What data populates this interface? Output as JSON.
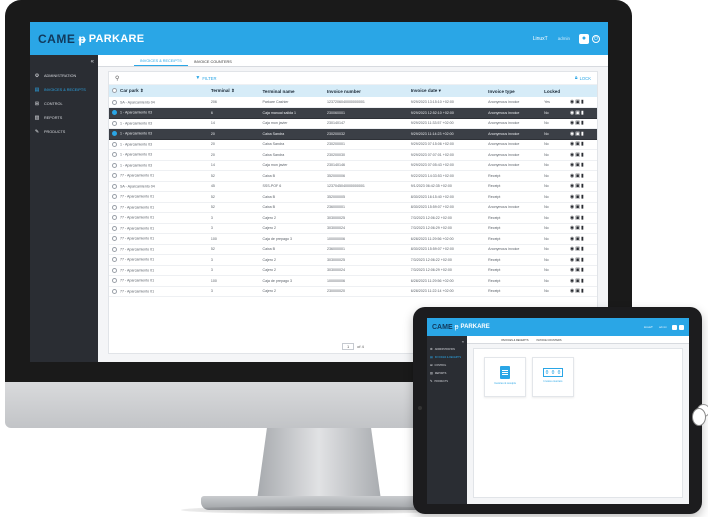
{
  "desktop": {
    "header": {
      "logo_came": "CAME",
      "logo_parkare": "PARKARE",
      "user_name": "LinuxT",
      "user_role": "admin"
    },
    "sidebar": {
      "collapse_symbol": "«",
      "items": [
        {
          "label": "ADMINISTRATION",
          "icon": "gear-icon",
          "glyph": "⚙",
          "active": false
        },
        {
          "label": "INVOICES & RECEIPTS",
          "icon": "receipt-icon",
          "glyph": "▤",
          "active": true
        },
        {
          "label": "CONTROL",
          "icon": "grid-icon",
          "glyph": "⊞",
          "active": false
        },
        {
          "label": "REPORTS",
          "icon": "bar-chart-icon",
          "glyph": "▥",
          "active": false
        },
        {
          "label": "PRODUCTS",
          "icon": "ticket-icon",
          "glyph": "✎",
          "active": false
        }
      ]
    },
    "tabs": [
      {
        "label": "INVOICES & RECEIPTS",
        "active": true
      },
      {
        "label": "INVOICE COUNTERS",
        "active": false
      }
    ],
    "toolbar": {
      "filter_label": "FILTER",
      "lock_label": "LOCK"
    },
    "table": {
      "columns": [
        "Car park",
        "Terminal",
        "Terminal name",
        "Invoice number",
        "Invoice date",
        "Invoice type",
        "Locked"
      ],
      "rows": [
        {
          "car_park": "SA - Aparcamiento 04",
          "terminal": "206",
          "terminal_name": "Parkare Cashier",
          "invoice_number": "1237206040000000001",
          "invoice_date": "9/29/2023 13:15:10 +02:00",
          "invoice_type": "Anonymous invoice",
          "locked": "Yes",
          "selected": false
        },
        {
          "car_park": "1 - Aparcamiento 03",
          "terminal": "6",
          "terminal_name": "Caja manual salida 1",
          "invoice_number": "230060001",
          "invoice_date": "9/29/2023 12:52:10 +02:00",
          "invoice_type": "Anonymous invoice",
          "locked": "No",
          "selected": true
        },
        {
          "car_park": "1 - Aparcamiento 03",
          "terminal": "14",
          "terminal_name": "Caja mon javier",
          "invoice_number": "230140147",
          "invoice_date": "9/29/2023 11:33:57 +02:00",
          "invoice_type": "Anonymous invoice",
          "locked": "No",
          "selected": false
        },
        {
          "car_park": "1 - Aparcamiento 03",
          "terminal": "20",
          "terminal_name": "Caixa Sandra",
          "invoice_number": "230200032",
          "invoice_date": "9/29/2023 11:14:23 +02:00",
          "invoice_type": "Anonymous invoice",
          "locked": "No",
          "selected": true
        },
        {
          "car_park": "1 - Aparcamiento 03",
          "terminal": "20",
          "terminal_name": "Caixa Sandra",
          "invoice_number": "230200001",
          "invoice_date": "9/29/2023 07:15:06 +02:00",
          "invoice_type": "Anonymous invoice",
          "locked": "No",
          "selected": false
        },
        {
          "car_park": "1 - Aparcamiento 03",
          "terminal": "20",
          "terminal_name": "Caixa Sandra",
          "invoice_number": "230200030",
          "invoice_date": "9/29/2023 07:07:01 +02:00",
          "invoice_type": "Anonymous invoice",
          "locked": "No",
          "selected": false
        },
        {
          "car_park": "1 - Aparcamiento 03",
          "terminal": "14",
          "terminal_name": "Caja mon javier",
          "invoice_number": "230140146",
          "invoice_date": "9/29/2023 07:05:43 +02:00",
          "invoice_type": "Anonymous invoice",
          "locked": "No",
          "selected": false
        },
        {
          "car_park": "77 - Aparcamiento 01",
          "terminal": "52",
          "terminal_name": "Caixa B",
          "invoice_number": "352000006",
          "invoice_date": "9/22/2023 14:33:53 +02:00",
          "invoice_type": "Receipt",
          "locked": "No",
          "selected": false
        },
        {
          "car_park": "SA - Aparcamiento 04",
          "terminal": "45",
          "terminal_name": "SSS-POF 6",
          "invoice_number": "1237045040000000001",
          "invoice_date": "9/1/2023 06:42:35 +02:00",
          "invoice_type": "Receipt",
          "locked": "No",
          "selected": false
        },
        {
          "car_park": "77 - Aparcamiento 01",
          "terminal": "52",
          "terminal_name": "Caixa B",
          "invoice_number": "352000005",
          "invoice_date": "8/30/2023 16:15:40 +02:00",
          "invoice_type": "Receipt",
          "locked": "No",
          "selected": false
        },
        {
          "car_park": "77 - Aparcamiento 01",
          "terminal": "52",
          "terminal_name": "Caixa B",
          "invoice_number": "236000001",
          "invoice_date": "8/30/2023 15:59:07 +02:00",
          "invoice_type": "Anonymous invoice",
          "locked": "No",
          "selected": false
        },
        {
          "car_park": "77 - Aparcamiento 01",
          "terminal": "3",
          "terminal_name": "Cajero 2",
          "invoice_number": "303000025",
          "invoice_date": "7/3/2023 12:06:22 +02:00",
          "invoice_type": "Receipt",
          "locked": "No",
          "selected": false
        },
        {
          "car_park": "77 - Aparcamiento 01",
          "terminal": "3",
          "terminal_name": "Cajero 2",
          "invoice_number": "303000024",
          "invoice_date": "7/3/2023 12:06:29 +02:00",
          "invoice_type": "Receipt",
          "locked": "No",
          "selected": false
        },
        {
          "car_park": "77 - Aparcamiento 01",
          "terminal": "100",
          "terminal_name": "Caja de prepago 3",
          "invoice_number": "100000006",
          "invoice_date": "6/28/2023 11:29:56 +02:00",
          "invoice_type": "Receipt",
          "locked": "No",
          "selected": false
        },
        {
          "car_park": "77 - Aparcamiento 01",
          "terminal": "52",
          "terminal_name": "Caixa B",
          "invoice_number": "236000001",
          "invoice_date": "8/30/2023 15:59:07 +02:00",
          "invoice_type": "Anonymous invoice",
          "locked": "No",
          "selected": false
        },
        {
          "car_park": "77 - Aparcamiento 01",
          "terminal": "3",
          "terminal_name": "Cajero 2",
          "invoice_number": "303000025",
          "invoice_date": "7/3/2023 12:06:22 +02:00",
          "invoice_type": "Receipt",
          "locked": "No",
          "selected": false
        },
        {
          "car_park": "77 - Aparcamiento 01",
          "terminal": "3",
          "terminal_name": "Cajero 2",
          "invoice_number": "303000024",
          "invoice_date": "7/3/2023 12:06:29 +02:00",
          "invoice_type": "Receipt",
          "locked": "No",
          "selected": false
        },
        {
          "car_park": "77 - Aparcamiento 01",
          "terminal": "100",
          "terminal_name": "Caja de prepago 3",
          "invoice_number": "100000006",
          "invoice_date": "6/28/2023 11:29:56 +02:00",
          "invoice_type": "Receipt",
          "locked": "No",
          "selected": false
        },
        {
          "car_park": "77 - Aparcamiento 01",
          "terminal": "3",
          "terminal_name": "Cajero 2",
          "invoice_number": "230000020",
          "invoice_date": "6/28/2023 11:22:14 +02:00",
          "invoice_type": "Receipt",
          "locked": "No",
          "selected": false
        }
      ]
    },
    "pager": {
      "current_page": "1",
      "total_label": "of 4"
    }
  },
  "tablet": {
    "header": {
      "logo_came": "CAME",
      "logo_parkare": "PARKARE",
      "user_name": "LinuxT",
      "user_role": "admin"
    },
    "sidebar": {
      "collapse_symbol": "«",
      "items": [
        {
          "label": "ADMINISTRATION",
          "glyph": "⚙",
          "active": false
        },
        {
          "label": "INVOICES & RECEIPTS",
          "glyph": "▤",
          "active": true
        },
        {
          "label": "CONTROL",
          "glyph": "⊞",
          "active": false
        },
        {
          "label": "REPORTS",
          "glyph": "▥",
          "active": false
        },
        {
          "label": "PRODUCTS",
          "glyph": "✎",
          "active": false
        }
      ]
    },
    "tabs": [
      {
        "label": "INVOICES & RECEIPTS"
      },
      {
        "label": "INVOICE COUNTERS"
      }
    ],
    "tiles": [
      {
        "label": "Invoices & receipts",
        "icon": "document-icon"
      },
      {
        "label": "Invoice counters",
        "icon": "counter-icon",
        "digits": [
          "0",
          "0",
          "0"
        ]
      }
    ]
  },
  "colors": {
    "brand_blue": "#2aa6e6",
    "brand_dark": "#11395c",
    "sidebar_bg": "#2a2d33",
    "selected_row": "#3b3f46"
  }
}
